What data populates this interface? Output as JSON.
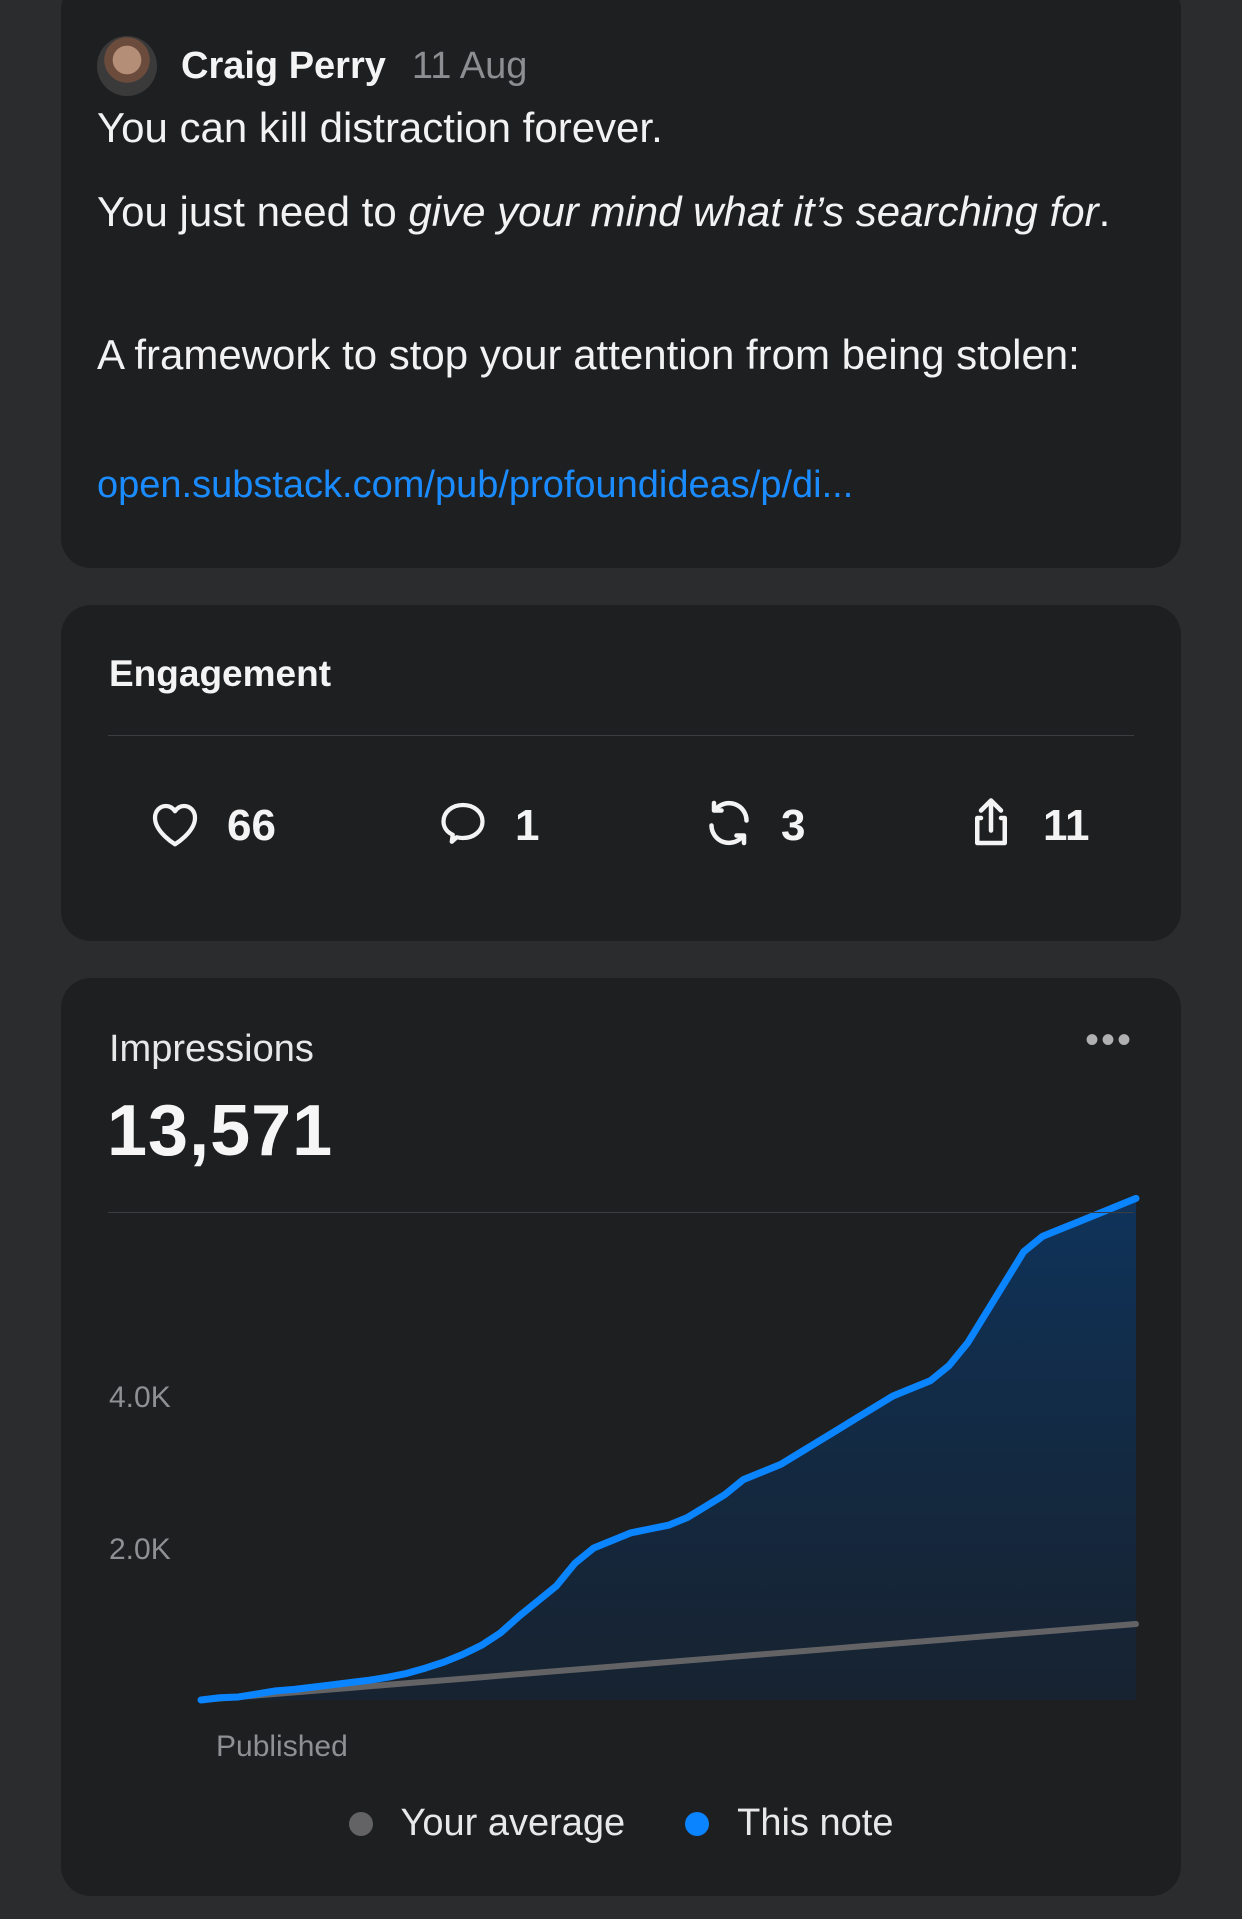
{
  "note": {
    "author": "Craig Perry",
    "date": "11 Aug",
    "para1": "You can kill distraction forever.",
    "para2_prefix": "You just need to ",
    "para2_emphasis": "give your mind what it’s searching for",
    "para2_suffix": ".",
    "para3": "A framework to stop your attention from being stolen:",
    "link": "open.substack.com/pub/profoundideas/p/di..."
  },
  "engagement": {
    "title": "Engagement",
    "likes": "66",
    "comments": "1",
    "restacks": "3",
    "shares": "11",
    "icons": [
      "heart-icon",
      "comment-icon",
      "restack-icon",
      "share-icon"
    ]
  },
  "impressions": {
    "label": "Impressions",
    "total": "13,571",
    "more": "•••"
  },
  "legend": {
    "average": "Your average",
    "this_note": "This note"
  },
  "colors": {
    "this_note": "#0a84ff",
    "average": "#636366",
    "link": "#1a8cff"
  },
  "chart_data": {
    "type": "area",
    "xlabel": "Published",
    "ylabel": "",
    "y_ticks": [
      "2.0K",
      "4.0K"
    ],
    "ylim": [
      0,
      5500
    ],
    "x": [
      0,
      1,
      2,
      3,
      4,
      5,
      6,
      7,
      8,
      9,
      10,
      11,
      12,
      13,
      14,
      15,
      16,
      17,
      18,
      19,
      20,
      21,
      22,
      23,
      24,
      25,
      26,
      27,
      28,
      29,
      30,
      31,
      32,
      33,
      34,
      35,
      36,
      37,
      38,
      39,
      40,
      41,
      42,
      43,
      44,
      45,
      46,
      47,
      48,
      49,
      50
    ],
    "series": [
      {
        "name": "This note",
        "values": [
          0,
          30,
          40,
          80,
          120,
          140,
          170,
          200,
          230,
          260,
          300,
          350,
          420,
          500,
          600,
          720,
          880,
          1100,
          1300,
          1500,
          1800,
          2000,
          2100,
          2200,
          2250,
          2300,
          2400,
          2550,
          2700,
          2900,
          3000,
          3100,
          3250,
          3400,
          3550,
          3700,
          3850,
          4000,
          4100,
          4200,
          4400,
          4700,
          5100,
          5500,
          5900,
          6100,
          6200,
          6300,
          6400,
          6500,
          6600
        ],
        "fill": true
      },
      {
        "name": "Your average",
        "values": [
          0,
          20,
          40,
          60,
          80,
          100,
          120,
          140,
          160,
          180,
          200,
          220,
          240,
          260,
          280,
          300,
          320,
          340,
          360,
          380,
          400,
          420,
          440,
          460,
          480,
          500,
          520,
          540,
          560,
          580,
          600,
          620,
          640,
          660,
          680,
          700,
          720,
          740,
          760,
          780,
          800,
          820,
          840,
          860,
          880,
          900,
          920,
          940,
          960,
          980,
          1000
        ]
      }
    ]
  }
}
